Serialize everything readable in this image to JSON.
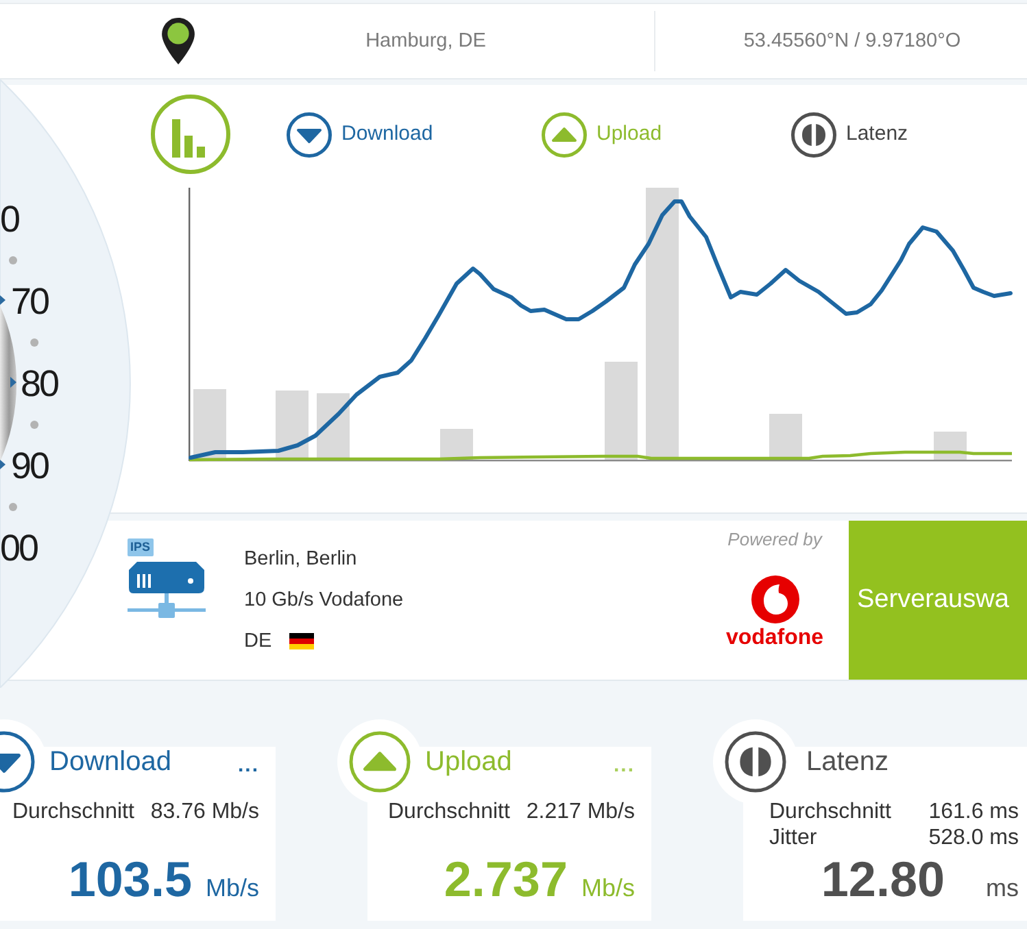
{
  "location": {
    "city": "Hamburg, DE",
    "coordinates": "53.45560°N / 9.97180°O"
  },
  "gauge": {
    "labels": [
      "0",
      "70",
      "80",
      "90",
      "00"
    ]
  },
  "chart": {
    "legend": [
      {
        "kind": "download",
        "label": "Download"
      },
      {
        "kind": "upload",
        "label": "Upload"
      },
      {
        "kind": "latency",
        "label": "Latenz"
      }
    ]
  },
  "server": {
    "tag": "IPS",
    "city": "Berlin, Berlin",
    "connection": "10 Gb/s Vodafone",
    "country": "DE",
    "powered_by": "Powered by",
    "provider": "vodafone",
    "button": "Serverauswa"
  },
  "results": [
    {
      "kind": "download",
      "title": "Download",
      "more": "...",
      "stats": [
        {
          "label": "Durchschnitt",
          "value": "83.76 Mb/s"
        }
      ],
      "value": "103.5",
      "unit": "Mb/s"
    },
    {
      "kind": "upload",
      "title": "Upload",
      "more": "...",
      "stats": [
        {
          "label": "Durchschnitt",
          "value": "2.217 Mb/s"
        }
      ],
      "value": "2.737",
      "unit": "Mb/s"
    },
    {
      "kind": "latency",
      "title": "Latenz",
      "stats": [
        {
          "label": "Durchschnitt",
          "value": "161.6 ms"
        },
        {
          "label": "Jitter",
          "value": "528.0 ms"
        }
      ],
      "value": "12.80",
      "unit": "ms"
    }
  ]
}
